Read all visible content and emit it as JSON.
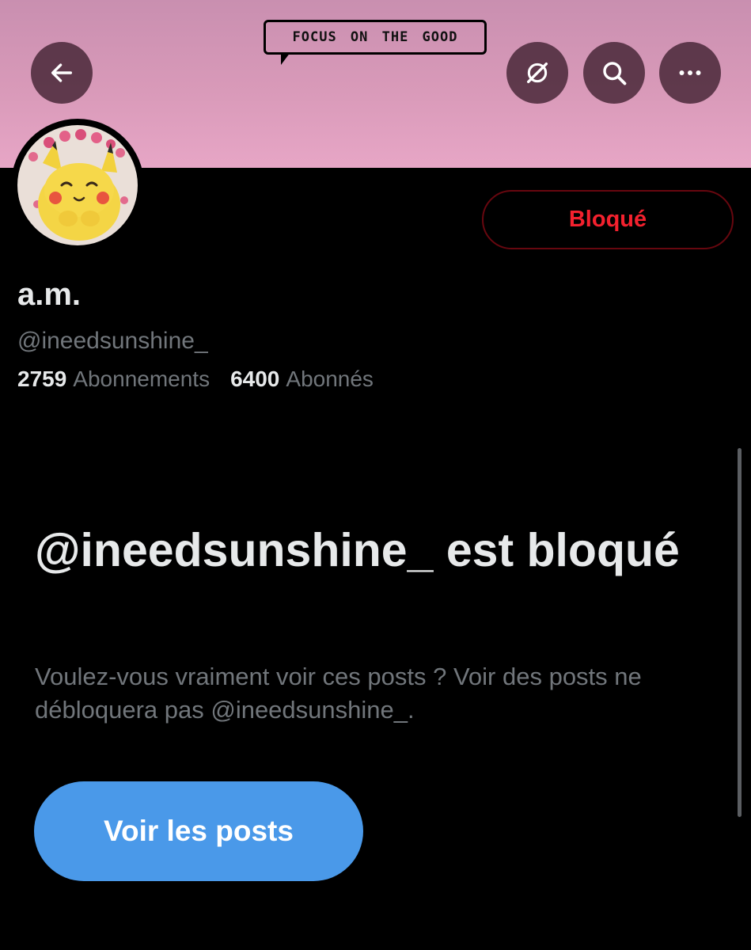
{
  "banner": {
    "speech_text": "FOCUS ON THE GOOD",
    "background_color": "#d99ab9"
  },
  "header": {
    "back_icon": "arrow-left-icon",
    "grok_icon": "grok-icon",
    "search_icon": "search-icon",
    "more_icon": "more-horizontal-icon"
  },
  "profile": {
    "avatar_icon": "pikachu-avatar",
    "blocked_button_label": "Bloqué",
    "display_name": "a.m.",
    "handle": "@ineedsunshine_",
    "following_count": "2759",
    "following_label": "Abonnements",
    "followers_count": "6400",
    "followers_label": "Abonnés"
  },
  "blocked_notice": {
    "title": "@ineedsunshine_ est bloqué",
    "description": "Voulez-vous vraiment voir ces posts ? Voir des posts ne débloquera pas @ineedsunshine_.",
    "view_posts_label": "Voir les posts"
  },
  "colors": {
    "accent_blue": "#4a99e9",
    "blocked_red": "#f4212e",
    "muted_text": "#71767b"
  }
}
